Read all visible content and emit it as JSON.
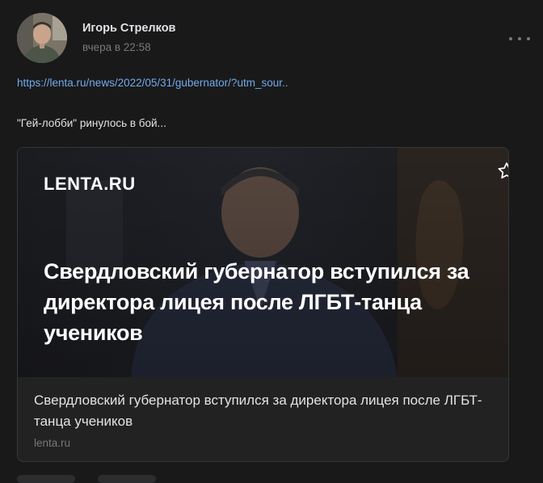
{
  "post": {
    "author": "Игорь Стрелков",
    "time": "вчера в 22:58",
    "link": "https://lenta.ru/news/2022/05/31/gubernator/?utm_sour..",
    "text": "\"Гей-лобби\" ринулось в бой..."
  },
  "card": {
    "brand": "LENTA.RU",
    "overlay_headline": "Свердловский губернатор вступился за директора лицея после ЛГБТ-танца учеников",
    "title": "Свердловский губернатор вступился за директора лицея после ЛГБТ-танца учеников",
    "domain": "lenta.ru"
  },
  "icons": {
    "more": "more-dots-icon",
    "bookmark": "star-icon"
  },
  "colors": {
    "background": "#19191a",
    "link": "#71aaeb",
    "secondary_text": "#76787a"
  }
}
